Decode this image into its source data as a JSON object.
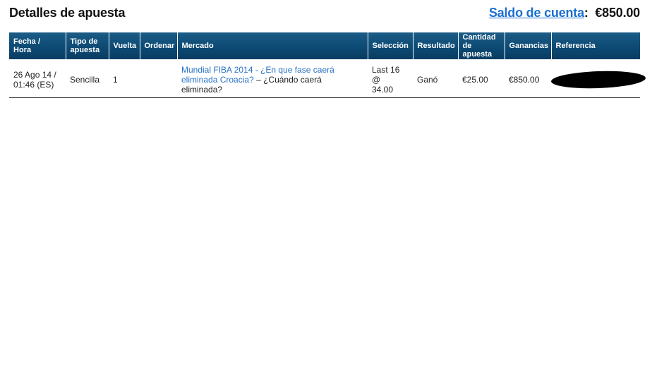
{
  "page": {
    "title": "Detalles de apuesta"
  },
  "balance": {
    "link_label": "Saldo de cuenta",
    "separator": ":",
    "amount": "€850.00"
  },
  "table": {
    "headers": {
      "fecha_line1": "Fecha /",
      "fecha_line2": "Hora",
      "tipo_line1": "Tipo de",
      "tipo_line2": "apuesta",
      "vuelta": "Vuelta",
      "ordenar": "Ordenar",
      "mercado": "Mercado",
      "seleccion": "Selección",
      "resultado": "Resultado",
      "cantidad_line1": "Cantidad",
      "cantidad_line2": "de apuesta",
      "ganancias": "Ganancias",
      "referencia": "Referencia"
    },
    "rows": [
      {
        "fecha_line1": "26 Ago 14 /",
        "fecha_line2": "01:46 (ES)",
        "tipo": "Sencilla",
        "vuelta": "1",
        "ordenar": "",
        "mercado_link": "Mundial FIBA 2014 - ¿En que fase caerá eliminada Croacia?",
        "mercado_separator": " – ",
        "mercado_question": "¿Cuándo caerá eliminada?",
        "seleccion_line1": "Last 16 @",
        "seleccion_line2": "34.00",
        "resultado": "Ganó",
        "cantidad": "€25.00",
        "ganancias": "€850.00",
        "referencia": ""
      }
    ]
  },
  "colors": {
    "header_bg": "#0d4a74",
    "link": "#1a6fd0",
    "market_link": "#2a72c6",
    "redaction": "#000000"
  }
}
